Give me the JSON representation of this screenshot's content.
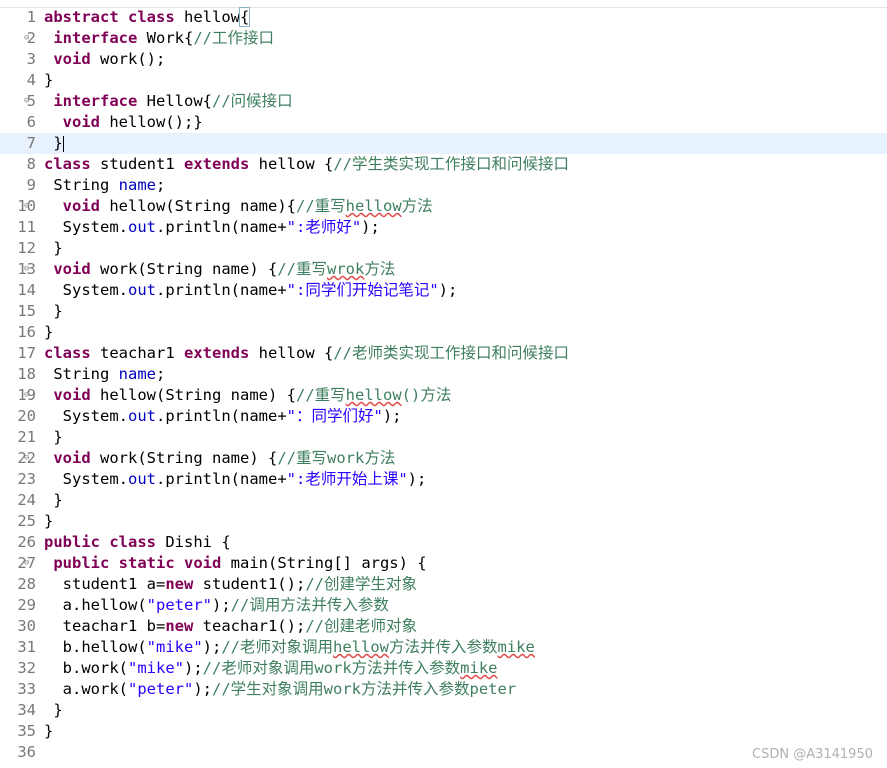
{
  "watermark": "CSDN @A3141950",
  "lines": [
    {
      "n": "1",
      "fold": "",
      "tokens": [
        [
          "abstract ",
          "kw"
        ],
        [
          "class ",
          "kw"
        ],
        [
          "hellow",
          ""
        ],
        [
          "{",
          "box"
        ]
      ]
    },
    {
      "n": "2",
      "fold": "⊖",
      "tokens": [
        [
          " ",
          ""
        ],
        [
          "interface ",
          "kw"
        ],
        [
          "Work{",
          ""
        ],
        [
          "//工作接口",
          "cm"
        ]
      ]
    },
    {
      "n": "3",
      "fold": "",
      "tokens": [
        [
          " ",
          ""
        ],
        [
          "void ",
          "kw"
        ],
        [
          "work();",
          ""
        ]
      ]
    },
    {
      "n": "4",
      "fold": "",
      "tokens": [
        [
          "}",
          ""
        ]
      ]
    },
    {
      "n": "5",
      "fold": "⊖",
      "tokens": [
        [
          " ",
          ""
        ],
        [
          "interface ",
          "kw"
        ],
        [
          "Hellow{",
          ""
        ],
        [
          "//问候接口",
          "cm"
        ]
      ]
    },
    {
      "n": "6",
      "fold": "",
      "tokens": [
        [
          "  ",
          ""
        ],
        [
          "void ",
          "kw"
        ],
        [
          "hellow();}",
          ""
        ]
      ]
    },
    {
      "n": "7",
      "fold": "",
      "current": true,
      "tokens": [
        [
          " }",
          ""
        ],
        [
          "",
          "caret"
        ]
      ]
    },
    {
      "n": "8",
      "fold": "",
      "tokens": [
        [
          "class ",
          "kw"
        ],
        [
          "student1 ",
          ""
        ],
        [
          "extends ",
          "kw"
        ],
        [
          "hellow {",
          ""
        ],
        [
          "//学生类实现工作接口和问候接口",
          "cm"
        ]
      ]
    },
    {
      "n": "9",
      "fold": "",
      "tokens": [
        [
          " String ",
          ""
        ],
        [
          "name",
          "fd"
        ],
        [
          ";",
          ""
        ]
      ]
    },
    {
      "n": "10",
      "fold": "⊖",
      "tokens": [
        [
          "  ",
          ""
        ],
        [
          "void ",
          "kw"
        ],
        [
          "hellow(String name){",
          ""
        ],
        [
          "//重写",
          "cm"
        ],
        [
          "hellow",
          "cm sq"
        ],
        [
          "方法",
          "cm"
        ]
      ]
    },
    {
      "n": "11",
      "fold": "",
      "tokens": [
        [
          "  System.",
          ""
        ],
        [
          "out",
          "fd"
        ],
        [
          ".println(name+",
          ""
        ],
        [
          "\":老师好\"",
          "st"
        ],
        [
          ");",
          ""
        ]
      ]
    },
    {
      "n": "12",
      "fold": "",
      "tokens": [
        [
          " }",
          ""
        ]
      ]
    },
    {
      "n": "13",
      "fold": "⊖",
      "tokens": [
        [
          " ",
          ""
        ],
        [
          "void ",
          "kw"
        ],
        [
          "work(String name) {",
          ""
        ],
        [
          "//重写",
          "cm"
        ],
        [
          "wrok",
          "cm sq"
        ],
        [
          "方法",
          "cm"
        ]
      ]
    },
    {
      "n": "14",
      "fold": "",
      "tokens": [
        [
          "  System.",
          ""
        ],
        [
          "out",
          "fd"
        ],
        [
          ".println(name+",
          ""
        ],
        [
          "\":同学们开始记笔记\"",
          "st"
        ],
        [
          ");",
          ""
        ]
      ]
    },
    {
      "n": "15",
      "fold": "",
      "tokens": [
        [
          " }",
          ""
        ]
      ]
    },
    {
      "n": "16",
      "fold": "",
      "tokens": [
        [
          "}",
          ""
        ]
      ]
    },
    {
      "n": "17",
      "fold": "",
      "tokens": [
        [
          "class ",
          "kw"
        ],
        [
          "teachar1 ",
          ""
        ],
        [
          "extends ",
          "kw"
        ],
        [
          "hellow {",
          ""
        ],
        [
          "//老师类实现工作接口和问候接口",
          "cm"
        ]
      ]
    },
    {
      "n": "18",
      "fold": "",
      "tokens": [
        [
          " String ",
          ""
        ],
        [
          "name",
          "fd"
        ],
        [
          ";",
          ""
        ]
      ]
    },
    {
      "n": "19",
      "fold": "⊖",
      "tokens": [
        [
          " ",
          ""
        ],
        [
          "void ",
          "kw"
        ],
        [
          "hellow(String name) {",
          ""
        ],
        [
          "//重写",
          "cm"
        ],
        [
          "hellow",
          "cm sq"
        ],
        [
          "()方法",
          "cm"
        ]
      ]
    },
    {
      "n": "20",
      "fold": "",
      "tokens": [
        [
          "  System.",
          ""
        ],
        [
          "out",
          "fd"
        ],
        [
          ".println(name+",
          ""
        ],
        [
          "\"：同学们好\"",
          "st"
        ],
        [
          ");",
          ""
        ]
      ]
    },
    {
      "n": "21",
      "fold": "",
      "tokens": [
        [
          " }",
          ""
        ]
      ]
    },
    {
      "n": "22",
      "fold": "⊖",
      "tokens": [
        [
          " ",
          ""
        ],
        [
          "void ",
          "kw"
        ],
        [
          "work(String name) {",
          ""
        ],
        [
          "//重写work方法",
          "cm"
        ]
      ]
    },
    {
      "n": "23",
      "fold": "",
      "tokens": [
        [
          "  System.",
          ""
        ],
        [
          "out",
          "fd"
        ],
        [
          ".println(name+",
          ""
        ],
        [
          "\":老师开始上课\"",
          "st"
        ],
        [
          ");",
          ""
        ]
      ]
    },
    {
      "n": "24",
      "fold": "",
      "tokens": [
        [
          " }",
          ""
        ]
      ]
    },
    {
      "n": "25",
      "fold": "",
      "tokens": [
        [
          "}",
          ""
        ]
      ]
    },
    {
      "n": "26",
      "fold": "",
      "tokens": [
        [
          "public ",
          "kw"
        ],
        [
          "class ",
          "kw"
        ],
        [
          "Dishi {",
          ""
        ]
      ]
    },
    {
      "n": "27",
      "fold": "⊖",
      "tokens": [
        [
          " ",
          ""
        ],
        [
          "public ",
          "kw"
        ],
        [
          "static ",
          "kw"
        ],
        [
          "void ",
          "kw"
        ],
        [
          "main(String[] args) {",
          ""
        ]
      ]
    },
    {
      "n": "28",
      "fold": "",
      "tokens": [
        [
          "  student1 a=",
          ""
        ],
        [
          "new ",
          "kw"
        ],
        [
          "student1();",
          ""
        ],
        [
          "//创建学生对象",
          "cm"
        ]
      ]
    },
    {
      "n": "29",
      "fold": "",
      "tokens": [
        [
          "  a.hellow(",
          ""
        ],
        [
          "\"peter\"",
          "st"
        ],
        [
          ");",
          ""
        ],
        [
          "//调用方法并传入参数",
          "cm"
        ]
      ]
    },
    {
      "n": "30",
      "fold": "",
      "tokens": [
        [
          "  teachar1 b=",
          ""
        ],
        [
          "new ",
          "kw"
        ],
        [
          "teachar1();",
          ""
        ],
        [
          "//创建老师对象",
          "cm"
        ]
      ]
    },
    {
      "n": "31",
      "fold": "",
      "tokens": [
        [
          "  b.hellow(",
          ""
        ],
        [
          "\"mike\"",
          "st"
        ],
        [
          ");",
          ""
        ],
        [
          "//老师对象调用",
          "cm"
        ],
        [
          "hellow",
          "cm sq"
        ],
        [
          "方法并传入参数",
          "cm"
        ],
        [
          "mike",
          "cm sq"
        ]
      ]
    },
    {
      "n": "32",
      "fold": "",
      "tokens": [
        [
          "  b.work(",
          ""
        ],
        [
          "\"mike\"",
          "st"
        ],
        [
          ");",
          ""
        ],
        [
          "//老师对象调用work方法并传入参数",
          "cm"
        ],
        [
          "mike",
          "cm sq"
        ]
      ]
    },
    {
      "n": "33",
      "fold": "",
      "tokens": [
        [
          "  a.work(",
          ""
        ],
        [
          "\"peter\"",
          "st"
        ],
        [
          ");",
          ""
        ],
        [
          "//学生对象调用work方法并传入参数peter",
          "cm"
        ]
      ]
    },
    {
      "n": "34",
      "fold": "",
      "tokens": [
        [
          " }",
          ""
        ]
      ]
    },
    {
      "n": "35",
      "fold": "",
      "tokens": [
        [
          "}",
          ""
        ]
      ]
    },
    {
      "n": "36",
      "fold": "",
      "tokens": []
    }
  ]
}
